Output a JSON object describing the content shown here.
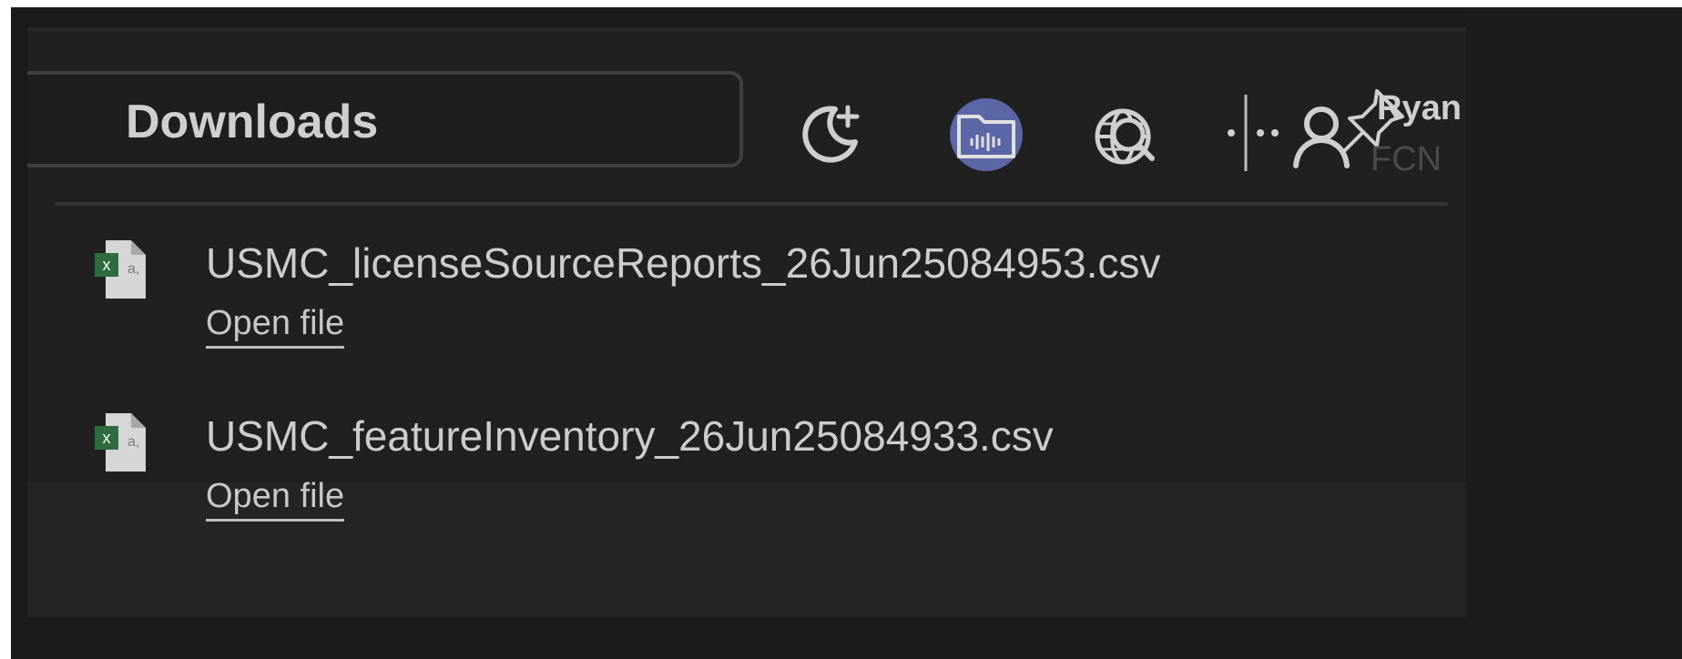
{
  "header": {
    "title": "Downloads"
  },
  "toolbar": {
    "icons": [
      "moon-sparkle-icon",
      "downloads-folder-icon",
      "globe-search-icon",
      "more-icon",
      "profile-icon",
      "pin-icon"
    ]
  },
  "user": {
    "name": "Ryan",
    "org": "FCN"
  },
  "downloads": [
    {
      "file_name": "USMC_licenseSourceReports_26Jun25084953.csv",
      "action": "Open file",
      "icon": "excel-csv-file-icon"
    },
    {
      "file_name": "USMC_featureInventory_26Jun25084933.csv",
      "action": "Open file",
      "icon": "excel-csv-file-icon"
    }
  ],
  "colors": {
    "background": "#1a1a1a",
    "panel": "#202020",
    "accent": "#5b66a6",
    "text": "#cdcdcd",
    "excel_green": "#2e6b3f"
  }
}
